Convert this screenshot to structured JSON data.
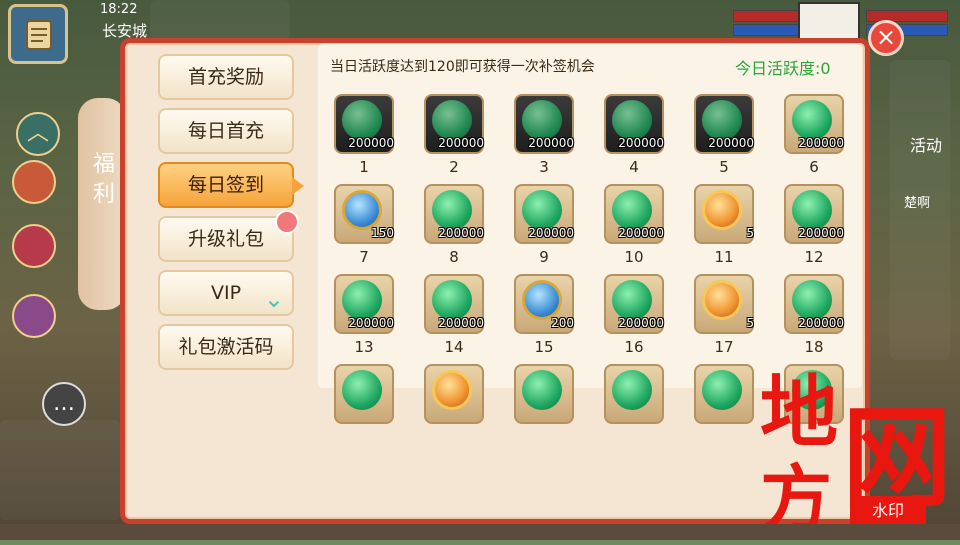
{
  "hud": {
    "clock": "18:22",
    "city": "长安城",
    "activity_label": "活动",
    "chat_snippet": "楚啊"
  },
  "panel": {
    "side_title": "福利",
    "notice": "当日活跃度达到120即可获得一次补签机会",
    "active_score": "今日活跃度:0",
    "close_label": "×"
  },
  "menu": [
    {
      "label": "首充奖励",
      "active": false
    },
    {
      "label": "每日首充",
      "active": false
    },
    {
      "label": "每日签到",
      "active": true
    },
    {
      "label": "升级礼包",
      "active": false
    },
    {
      "label": "VIP",
      "active": false
    },
    {
      "label": "礼包激活码",
      "active": false
    }
  ],
  "rewards": [
    {
      "day": "1",
      "qty": "200000",
      "item": "jade-cloud",
      "state": "claimed"
    },
    {
      "day": "2",
      "qty": "200000",
      "item": "jade-cloud",
      "state": "claimed"
    },
    {
      "day": "3",
      "qty": "200000",
      "item": "jade-cloud",
      "state": "claimed"
    },
    {
      "day": "4",
      "qty": "200000",
      "item": "jade-cloud",
      "state": "claimed"
    },
    {
      "day": "5",
      "qty": "200000",
      "item": "jade-cloud",
      "state": "claimed"
    },
    {
      "day": "6",
      "qty": "200000",
      "item": "jade-cloud",
      "state": "available"
    },
    {
      "day": "7",
      "qty": "150",
      "item": "sapphire-orb",
      "state": "locked"
    },
    {
      "day": "8",
      "qty": "200000",
      "item": "jade-cloud",
      "state": "locked"
    },
    {
      "day": "9",
      "qty": "200000",
      "item": "jade-cloud",
      "state": "locked"
    },
    {
      "day": "10",
      "qty": "200000",
      "item": "jade-cloud",
      "state": "locked"
    },
    {
      "day": "11",
      "qty": "5",
      "item": "gold-coin",
      "state": "locked"
    },
    {
      "day": "12",
      "qty": "200000",
      "item": "jade-cloud",
      "state": "locked"
    },
    {
      "day": "13",
      "qty": "200000",
      "item": "jade-cloud",
      "state": "locked"
    },
    {
      "day": "14",
      "qty": "200000",
      "item": "jade-cloud",
      "state": "locked"
    },
    {
      "day": "15",
      "qty": "200",
      "item": "sapphire-orb",
      "state": "locked"
    },
    {
      "day": "16",
      "qty": "200000",
      "item": "jade-cloud",
      "state": "locked"
    },
    {
      "day": "17",
      "qty": "5",
      "item": "gold-coin",
      "state": "locked"
    },
    {
      "day": "18",
      "qty": "200000",
      "item": "jade-cloud",
      "state": "locked"
    },
    {
      "day": "",
      "qty": "",
      "item": "jade-cloud",
      "state": "locked"
    },
    {
      "day": "",
      "qty": "",
      "item": "gold-coin",
      "state": "locked"
    },
    {
      "day": "",
      "qty": "",
      "item": "jade-cloud",
      "state": "locked"
    },
    {
      "day": "",
      "qty": "",
      "item": "jade-cloud",
      "state": "locked"
    },
    {
      "day": "",
      "qty": "",
      "item": "jade-cloud",
      "state": "locked"
    },
    {
      "day": "",
      "qty": "",
      "item": "jade-cloud",
      "state": "locked"
    }
  ],
  "watermark": {
    "char_1": "地",
    "char_2": "方",
    "char_3": "网",
    "badge": "水印"
  },
  "colors": {
    "panel_border": "#c9402f",
    "active_tab": "#f6a43a",
    "score_green": "#2aa638",
    "watermark_red": "#e8170f"
  }
}
